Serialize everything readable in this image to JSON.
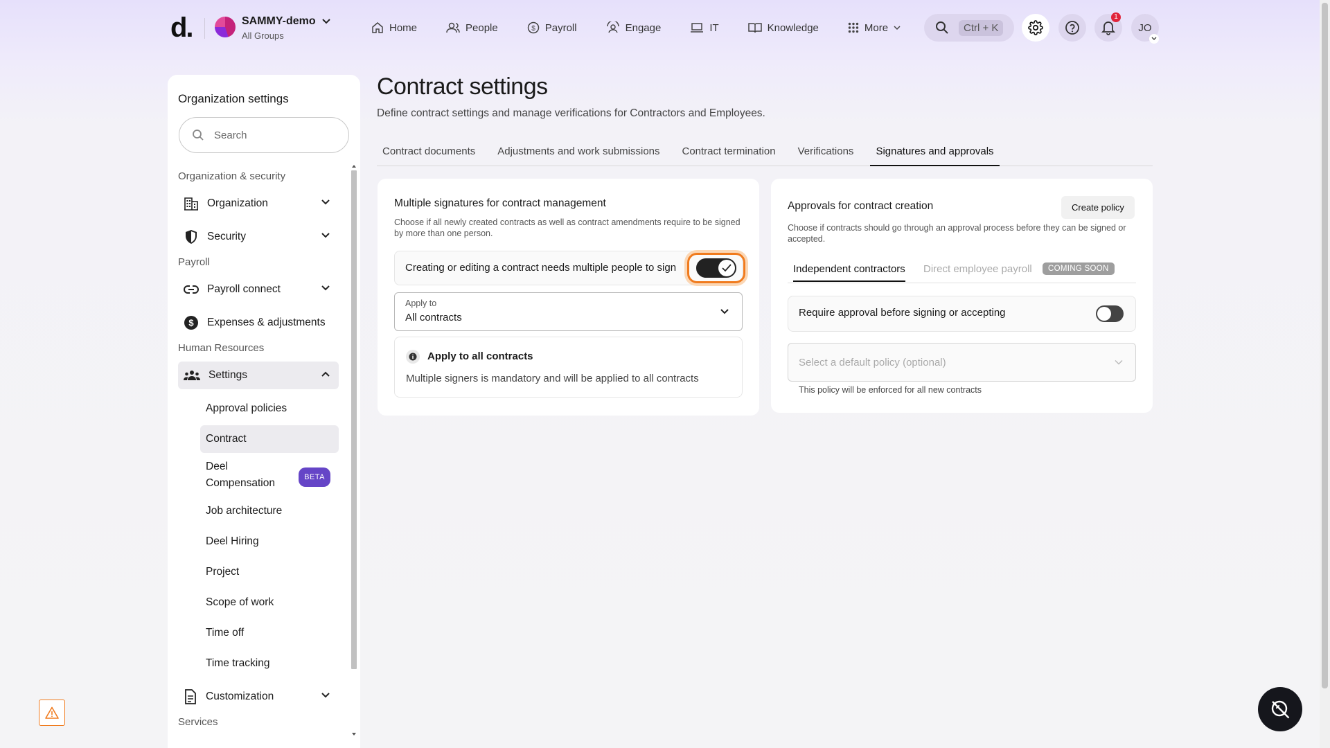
{
  "header": {
    "logo": "d.",
    "org_name": "SAMMY-demo",
    "org_sub": "All Groups",
    "nav": [
      {
        "label": "Home",
        "icon": "home-icon"
      },
      {
        "label": "People",
        "icon": "people-icon"
      },
      {
        "label": "Payroll",
        "icon": "payroll-icon"
      },
      {
        "label": "Engage",
        "icon": "engage-icon"
      },
      {
        "label": "IT",
        "icon": "laptop-icon"
      },
      {
        "label": "Knowledge",
        "icon": "book-icon"
      },
      {
        "label": "More",
        "icon": "grid-icon"
      }
    ],
    "search_shortcut": "Ctrl + K",
    "notification_count": "1",
    "user_initials": "JO"
  },
  "sidebar": {
    "title": "Organization settings",
    "search_placeholder": "Search",
    "sections": {
      "org_security": "Organization & security",
      "payroll": "Payroll",
      "hr": "Human Resources",
      "services": "Services"
    },
    "items": {
      "organization": "Organization",
      "security": "Security",
      "payroll_connect": "Payroll connect",
      "expenses": "Expenses & adjustments",
      "settings": "Settings",
      "customization": "Customization"
    },
    "sub_items": {
      "approval_policies": "Approval policies",
      "contract": "Contract",
      "deel_comp_1": "Deel",
      "deel_comp_2": "Compensation",
      "beta": "BETA",
      "job_architecture": "Job architecture",
      "deel_hiring": "Deel Hiring",
      "project": "Project",
      "scope_of_work": "Scope of work",
      "time_off": "Time off",
      "time_tracking": "Time tracking"
    }
  },
  "main": {
    "title": "Contract settings",
    "description": "Define contract settings and manage verifications for Contractors and Employees.",
    "tabs": [
      "Contract documents",
      "Adjustments and work submissions",
      "Contract termination",
      "Verifications",
      "Signatures and approvals"
    ],
    "selected_tab": "Signatures and approvals"
  },
  "left_card": {
    "title": "Multiple signatures for contract management",
    "description": "Choose if all newly created contracts as well as contract amendments require to be signed by more than one person.",
    "toggle_label": "Creating or editing a contract needs multiple people to sign",
    "toggle_on": true,
    "apply_to_label": "Apply to",
    "apply_to_value": "All contracts",
    "info_title": "Apply to all contracts",
    "info_text": "Multiple signers is mandatory and will be applied to all contracts"
  },
  "right_card": {
    "title": "Approvals for contract creation",
    "create_button": "Create policy",
    "description": "Choose if contracts should go through an approval process before they can be signed or accepted.",
    "tabs": [
      "Independent contractors",
      "Direct employee payroll"
    ],
    "coming_soon": "COMING SOON",
    "toggle_label": "Require approval before signing or accepting",
    "toggle_on": false,
    "policy_placeholder": "Select a default policy (optional)",
    "policy_note": "This policy will be enforced for all new contracts"
  }
}
